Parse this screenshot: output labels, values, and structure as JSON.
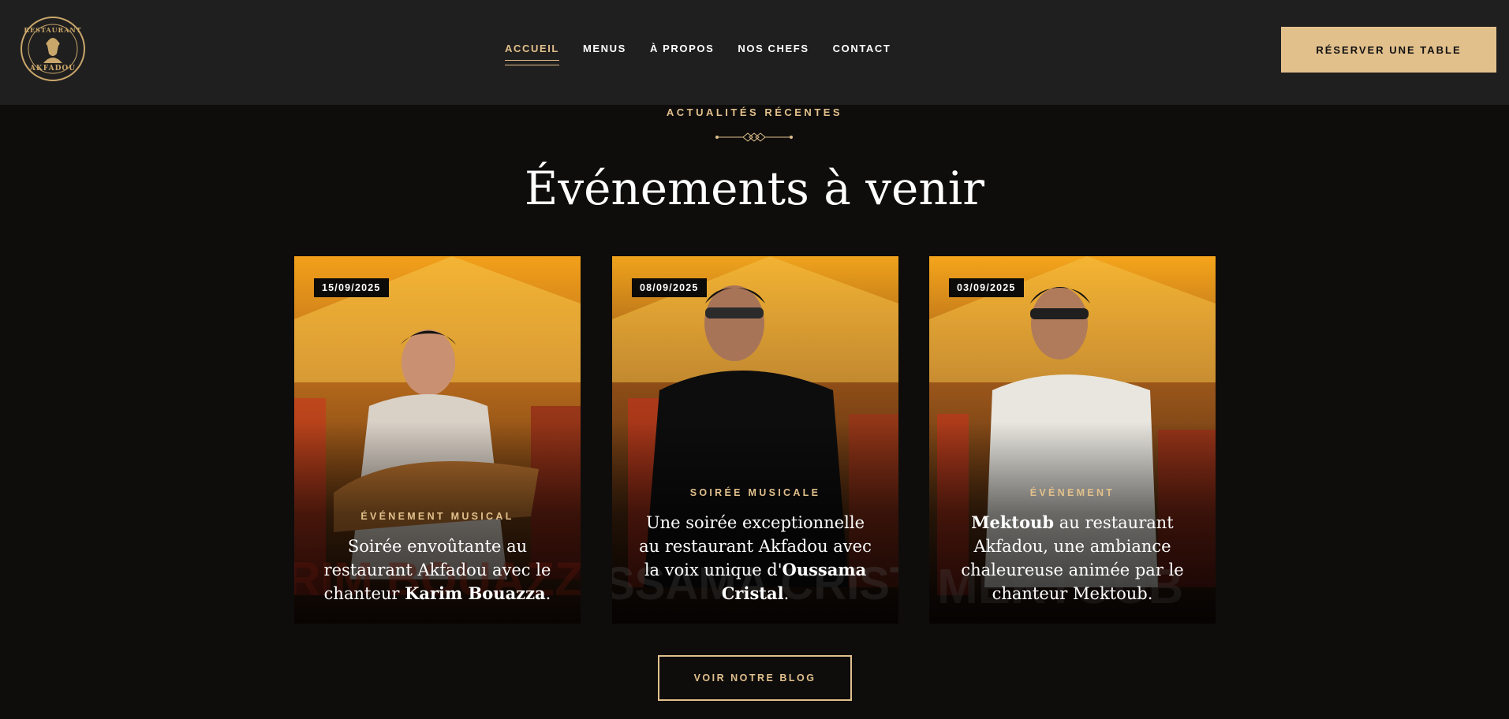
{
  "brand": {
    "logo_top": "RESTAURANT",
    "logo_bottom": "AKFADOU"
  },
  "nav": {
    "items": [
      {
        "label": "ACCUEIL",
        "active": true
      },
      {
        "label": "MENUS"
      },
      {
        "label": "À PROPOS"
      },
      {
        "label": "NOS CHEFS"
      },
      {
        "label": "CONTACT"
      }
    ]
  },
  "header": {
    "reserve_label": "RÉSERVER UNE TABLE"
  },
  "section": {
    "eyebrow": "ACTUALITÉS RÉCENTES",
    "title": "Événements à venir"
  },
  "cards": [
    {
      "date": "15/09/2025",
      "category": "ÉVÉNEMENT MUSICAL",
      "text_before": "Soirée envoûtante au restaurant Akfadou avec le chanteur ",
      "text_bold": "Karim Bouazza",
      "text_after": "."
    },
    {
      "date": "08/09/2025",
      "category": "SOIRÉE MUSICALE",
      "text_before": "Une soirée exceptionnelle au restaurant Akfadou avec la voix unique d'",
      "text_bold": "Oussama Cristal",
      "text_after": "."
    },
    {
      "date": "03/09/2025",
      "category": "ÉVÉNEMENT",
      "text_bold": "Mektoub",
      "text_after": " au restaurant Akfadou, une ambiance chaleureuse animée par le chanteur Mektoub."
    }
  ],
  "blog_button": "VOIR NOTRE BLOG",
  "colors": {
    "accent": "#e2c08c",
    "header_bg": "#201f1f",
    "page_bg": "#0e0d0c"
  }
}
